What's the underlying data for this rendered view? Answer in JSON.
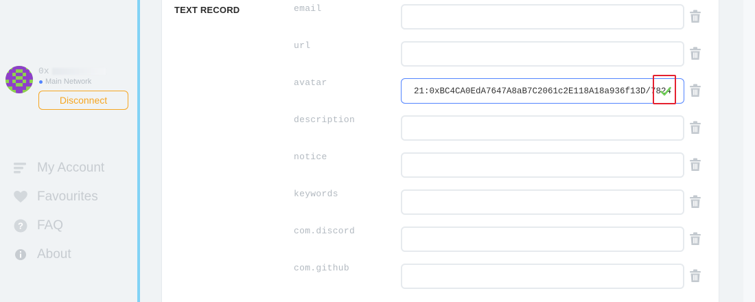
{
  "account": {
    "address": "0x",
    "network": "Main Network",
    "disconnect_label": "Disconnect",
    "avatar_icon": "identicon-avatar"
  },
  "nav": {
    "items": [
      {
        "label": "My Account",
        "icon": "list-icon"
      },
      {
        "label": "Favourites",
        "icon": "heart-icon"
      },
      {
        "label": "FAQ",
        "icon": "question-icon"
      },
      {
        "label": "About",
        "icon": "info-icon"
      }
    ]
  },
  "section": {
    "title": "TEXT RECORD"
  },
  "records": [
    {
      "key": "email",
      "value": ""
    },
    {
      "key": "url",
      "value": ""
    },
    {
      "key": "avatar",
      "value": "21:0xBC4CA0EdA7647A8aB7C2061c2E118A18a936f13D/7824"
    },
    {
      "key": "description",
      "value": ""
    },
    {
      "key": "notice",
      "value": ""
    },
    {
      "key": "keywords",
      "value": ""
    },
    {
      "key": "com.discord",
      "value": ""
    },
    {
      "key": "com.github",
      "value": ""
    }
  ],
  "colors": {
    "accent": "#5284ff",
    "warning": "#f5a623",
    "sidebar_border": "#82d2f5",
    "highlight": "#e5202f",
    "valid": "#6fcf57"
  }
}
